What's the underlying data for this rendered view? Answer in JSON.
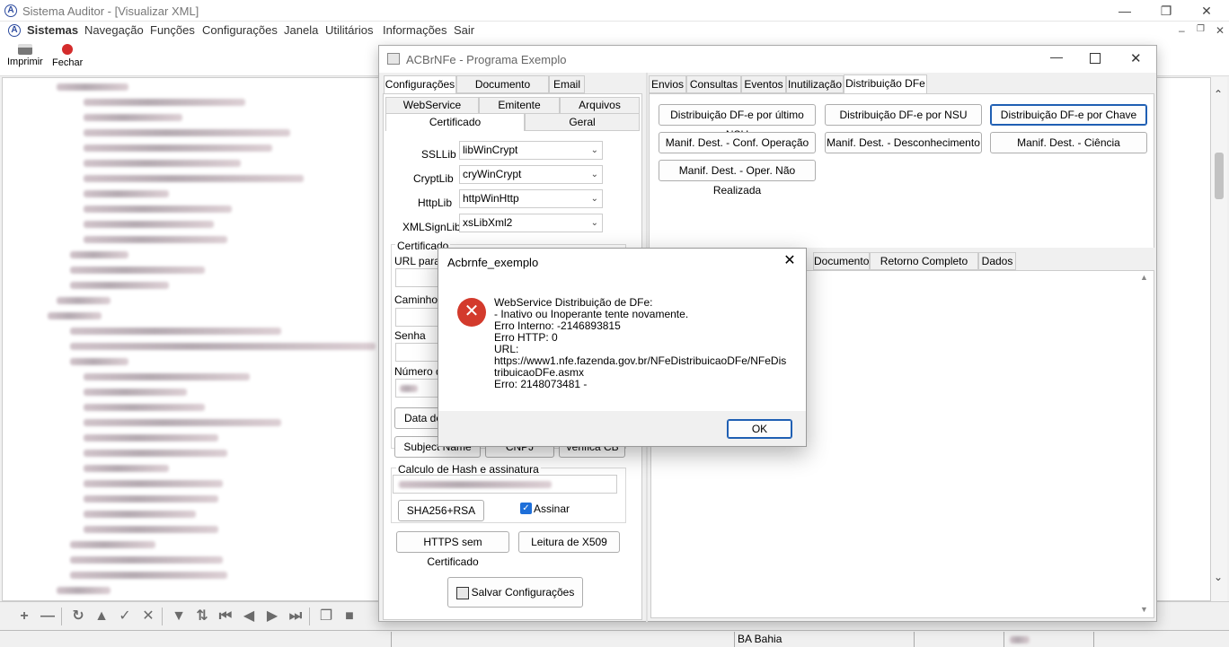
{
  "main_window": {
    "title": "Sistema Auditor - [Visualizar XML]",
    "menu": [
      "Sistemas",
      "Navegação",
      "Funções",
      "Configurações",
      "Janela",
      "Utilitários",
      "Informações",
      "Sair"
    ],
    "toolbar": {
      "print_label": "Imprimir",
      "close_label": "Fechar"
    }
  },
  "statusbar": {
    "state": "BA Bahia"
  },
  "acbr": {
    "title": "ACBrNFe - Programa Exemplo",
    "left_tabs": [
      "Configurações",
      "Documento Auxiliar",
      "Email"
    ],
    "sub_tabs_row1": [
      "WebService",
      "Emitente",
      "Arquivos"
    ],
    "sub_tabs_row2": [
      "Certificado",
      "Geral"
    ],
    "ssllib": {
      "label": "SSLLib",
      "value": "libWinCrypt"
    },
    "cryptlib": {
      "label": "CryptLib",
      "value": "cryWinCrypt"
    },
    "httplib": {
      "label": "HttpLib",
      "value": "httpWinHttp"
    },
    "xmlsignlib": {
      "label": "XMLSignLib",
      "value": "xsLibXml2"
    },
    "cert_group": "Certificado",
    "url_label": "URL para l",
    "path_label": "Caminho",
    "password_label": "Senha",
    "number_label": "Número de",
    "date_btn": "Data de",
    "subject_btn": "Subject Name",
    "cnpj_btn": "CNPJ",
    "verify_btn": "Verifica CB",
    "hash_group": "Calculo de Hash e assinatura",
    "sha_btn": "SHA256+RSA",
    "sign_check": "Assinar",
    "https_btn": "HTTPS sem Certificado",
    "x509_btn": "Leitura de X509",
    "save_btn": "Salvar Configurações",
    "right_tabs": [
      "Envios",
      "Consultas",
      "Eventos",
      "Inutilização",
      "Distribuição DFe"
    ],
    "dfe_buttons": [
      "Distribuição DF-e por último NSU",
      "Distribuição DF-e por NSU",
      "Distribuição DF-e por Chave",
      "Manif. Dest. - Conf. Operação",
      "Manif. Dest. - Desconhecimento",
      "Manif. Dest. - Ciência",
      "Manif. Dest. - Oper. Não Realizada"
    ],
    "bottom_tabs": [
      "Documento",
      "Retorno Completo WS",
      "Dados"
    ]
  },
  "dialog": {
    "title": "Acbrnfe_exemplo",
    "message": "WebService Distribuição de DFe:\n- Inativo ou Inoperante tente novamente.\nErro Interno: -2146893815\nErro HTTP: 0\nURL:\nhttps://www1.nfe.fazenda.gov.br/NFeDistribuicaoDFe/NFeDis\ntribuicaoDFe.asmx\nErro: 2148073481 -",
    "ok_label": "OK"
  }
}
